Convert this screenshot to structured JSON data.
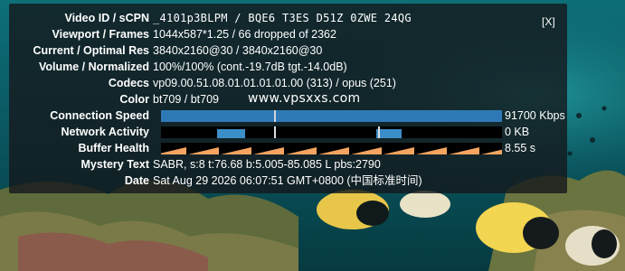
{
  "colors": {
    "panel_bg": "#14181c",
    "connection_bar": "#2f7ab6",
    "network_block": "#3c8ec9",
    "buffer_ramp": "#f4a460"
  },
  "close_label": "[X]",
  "watermark": "www.vpsxxs.com",
  "rows": {
    "video_id": {
      "label": "Video ID / sCPN",
      "value": "_4101p3BLPM / BQE6 T3ES D51Z 0ZWE 24QG"
    },
    "viewport": {
      "label": "Viewport / Frames",
      "value": "1044x587*1.25 / 66 dropped of 2362"
    },
    "resolution": {
      "label": "Current / Optimal Res",
      "value": "3840x2160@30 / 3840x2160@30"
    },
    "volume": {
      "label": "Volume / Normalized",
      "value": "100%/100% (cont.-19.7dB tgt.-14.0dB)"
    },
    "codecs": {
      "label": "Codecs",
      "value": "vp09.00.51.08.01.01.01.01.00 (313) / opus (251)"
    },
    "color": {
      "label": "Color",
      "value": "bt709 / bt709"
    },
    "connection_speed": {
      "label": "Connection Speed",
      "value": "91700 Kbps",
      "level": 1.0
    },
    "network_activity": {
      "label": "Network Activity",
      "value": "0 KB"
    },
    "buffer_health": {
      "label": "Buffer Health",
      "value": "8.55 s"
    },
    "mystery_text": {
      "label": "Mystery Text",
      "value": "SABR, s:8 t:76.68 b:5.005-85.085 L pbs:2790"
    },
    "date": {
      "label": "Date",
      "value": "Sat Aug 29 2026 06:07:51 GMT+0800 (中国标准时间)"
    }
  },
  "video_background": {
    "icon": "underwater-reef-video-frame"
  }
}
